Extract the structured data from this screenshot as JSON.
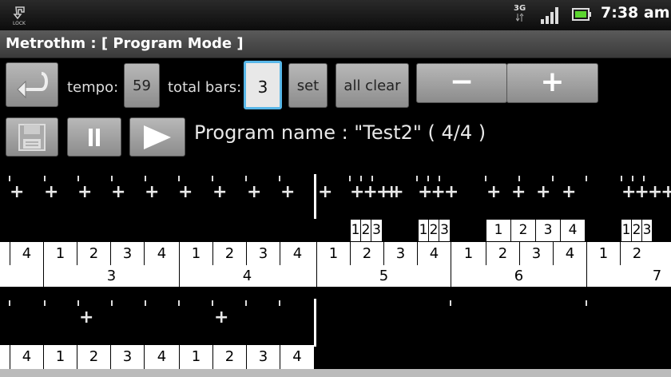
{
  "status": {
    "network": "3G",
    "time": "7:38 am"
  },
  "title": "Metrothm : [ Program Mode ]",
  "controls": {
    "tempo_label": "tempo:",
    "tempo_value": "59",
    "total_bars_label": "total bars:",
    "total_bars_value": "3",
    "set_label": "set",
    "all_clear_label": "all clear",
    "minus_symbol": "−",
    "plus_symbol": "+"
  },
  "program": {
    "name_text": "Program name : \"Test2\" ( 4/4 )"
  },
  "track1": {
    "beats": [
      "4",
      "1",
      "2",
      "3",
      "4",
      "1",
      "2",
      "3",
      "4",
      "1",
      "2",
      "3",
      "4",
      "1",
      "2",
      "3",
      "4",
      "1",
      "2"
    ],
    "bars": [
      "3",
      "4",
      "5",
      "6",
      "7"
    ],
    "subdivisions": [
      "1",
      "2",
      "3",
      "1",
      "2",
      "3",
      "1",
      "2",
      "3",
      "4",
      "1",
      "2",
      "3"
    ]
  },
  "track2": {
    "beats": [
      "4",
      "1",
      "2",
      "3",
      "4",
      "1",
      "2",
      "3",
      "4"
    ]
  }
}
